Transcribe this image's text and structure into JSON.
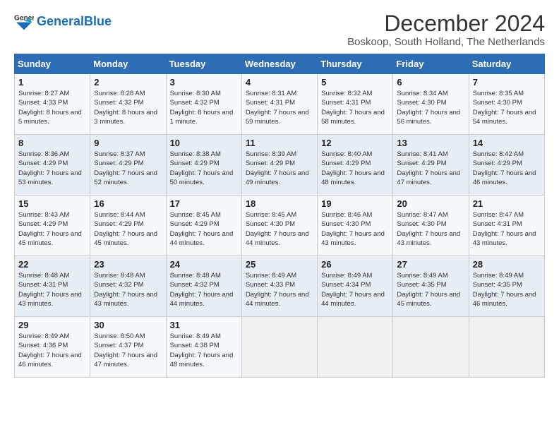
{
  "logo": {
    "text_general": "General",
    "text_blue": "Blue"
  },
  "title": "December 2024",
  "subtitle": "Boskoop, South Holland, The Netherlands",
  "weekdays": [
    "Sunday",
    "Monday",
    "Tuesday",
    "Wednesday",
    "Thursday",
    "Friday",
    "Saturday"
  ],
  "weeks": [
    [
      {
        "day": "1",
        "sunrise": "Sunrise: 8:27 AM",
        "sunset": "Sunset: 4:33 PM",
        "daylight": "Daylight: 8 hours and 5 minutes."
      },
      {
        "day": "2",
        "sunrise": "Sunrise: 8:28 AM",
        "sunset": "Sunset: 4:32 PM",
        "daylight": "Daylight: 8 hours and 3 minutes."
      },
      {
        "day": "3",
        "sunrise": "Sunrise: 8:30 AM",
        "sunset": "Sunset: 4:32 PM",
        "daylight": "Daylight: 8 hours and 1 minute."
      },
      {
        "day": "4",
        "sunrise": "Sunrise: 8:31 AM",
        "sunset": "Sunset: 4:31 PM",
        "daylight": "Daylight: 7 hours and 59 minutes."
      },
      {
        "day": "5",
        "sunrise": "Sunrise: 8:32 AM",
        "sunset": "Sunset: 4:31 PM",
        "daylight": "Daylight: 7 hours and 58 minutes."
      },
      {
        "day": "6",
        "sunrise": "Sunrise: 8:34 AM",
        "sunset": "Sunset: 4:30 PM",
        "daylight": "Daylight: 7 hours and 56 minutes."
      },
      {
        "day": "7",
        "sunrise": "Sunrise: 8:35 AM",
        "sunset": "Sunset: 4:30 PM",
        "daylight": "Daylight: 7 hours and 54 minutes."
      }
    ],
    [
      {
        "day": "8",
        "sunrise": "Sunrise: 8:36 AM",
        "sunset": "Sunset: 4:29 PM",
        "daylight": "Daylight: 7 hours and 53 minutes."
      },
      {
        "day": "9",
        "sunrise": "Sunrise: 8:37 AM",
        "sunset": "Sunset: 4:29 PM",
        "daylight": "Daylight: 7 hours and 52 minutes."
      },
      {
        "day": "10",
        "sunrise": "Sunrise: 8:38 AM",
        "sunset": "Sunset: 4:29 PM",
        "daylight": "Daylight: 7 hours and 50 minutes."
      },
      {
        "day": "11",
        "sunrise": "Sunrise: 8:39 AM",
        "sunset": "Sunset: 4:29 PM",
        "daylight": "Daylight: 7 hours and 49 minutes."
      },
      {
        "day": "12",
        "sunrise": "Sunrise: 8:40 AM",
        "sunset": "Sunset: 4:29 PM",
        "daylight": "Daylight: 7 hours and 48 minutes."
      },
      {
        "day": "13",
        "sunrise": "Sunrise: 8:41 AM",
        "sunset": "Sunset: 4:29 PM",
        "daylight": "Daylight: 7 hours and 47 minutes."
      },
      {
        "day": "14",
        "sunrise": "Sunrise: 8:42 AM",
        "sunset": "Sunset: 4:29 PM",
        "daylight": "Daylight: 7 hours and 46 minutes."
      }
    ],
    [
      {
        "day": "15",
        "sunrise": "Sunrise: 8:43 AM",
        "sunset": "Sunset: 4:29 PM",
        "daylight": "Daylight: 7 hours and 45 minutes."
      },
      {
        "day": "16",
        "sunrise": "Sunrise: 8:44 AM",
        "sunset": "Sunset: 4:29 PM",
        "daylight": "Daylight: 7 hours and 45 minutes."
      },
      {
        "day": "17",
        "sunrise": "Sunrise: 8:45 AM",
        "sunset": "Sunset: 4:29 PM",
        "daylight": "Daylight: 7 hours and 44 minutes."
      },
      {
        "day": "18",
        "sunrise": "Sunrise: 8:45 AM",
        "sunset": "Sunset: 4:30 PM",
        "daylight": "Daylight: 7 hours and 44 minutes."
      },
      {
        "day": "19",
        "sunrise": "Sunrise: 8:46 AM",
        "sunset": "Sunset: 4:30 PM",
        "daylight": "Daylight: 7 hours and 43 minutes."
      },
      {
        "day": "20",
        "sunrise": "Sunrise: 8:47 AM",
        "sunset": "Sunset: 4:30 PM",
        "daylight": "Daylight: 7 hours and 43 minutes."
      },
      {
        "day": "21",
        "sunrise": "Sunrise: 8:47 AM",
        "sunset": "Sunset: 4:31 PM",
        "daylight": "Daylight: 7 hours and 43 minutes."
      }
    ],
    [
      {
        "day": "22",
        "sunrise": "Sunrise: 8:48 AM",
        "sunset": "Sunset: 4:31 PM",
        "daylight": "Daylight: 7 hours and 43 minutes."
      },
      {
        "day": "23",
        "sunrise": "Sunrise: 8:48 AM",
        "sunset": "Sunset: 4:32 PM",
        "daylight": "Daylight: 7 hours and 43 minutes."
      },
      {
        "day": "24",
        "sunrise": "Sunrise: 8:48 AM",
        "sunset": "Sunset: 4:32 PM",
        "daylight": "Daylight: 7 hours and 44 minutes."
      },
      {
        "day": "25",
        "sunrise": "Sunrise: 8:49 AM",
        "sunset": "Sunset: 4:33 PM",
        "daylight": "Daylight: 7 hours and 44 minutes."
      },
      {
        "day": "26",
        "sunrise": "Sunrise: 8:49 AM",
        "sunset": "Sunset: 4:34 PM",
        "daylight": "Daylight: 7 hours and 44 minutes."
      },
      {
        "day": "27",
        "sunrise": "Sunrise: 8:49 AM",
        "sunset": "Sunset: 4:35 PM",
        "daylight": "Daylight: 7 hours and 45 minutes."
      },
      {
        "day": "28",
        "sunrise": "Sunrise: 8:49 AM",
        "sunset": "Sunset: 4:35 PM",
        "daylight": "Daylight: 7 hours and 46 minutes."
      }
    ],
    [
      {
        "day": "29",
        "sunrise": "Sunrise: 8:49 AM",
        "sunset": "Sunset: 4:36 PM",
        "daylight": "Daylight: 7 hours and 46 minutes."
      },
      {
        "day": "30",
        "sunrise": "Sunrise: 8:50 AM",
        "sunset": "Sunset: 4:37 PM",
        "daylight": "Daylight: 7 hours and 47 minutes."
      },
      {
        "day": "31",
        "sunrise": "Sunrise: 8:49 AM",
        "sunset": "Sunset: 4:38 PM",
        "daylight": "Daylight: 7 hours and 48 minutes."
      },
      null,
      null,
      null,
      null
    ]
  ]
}
